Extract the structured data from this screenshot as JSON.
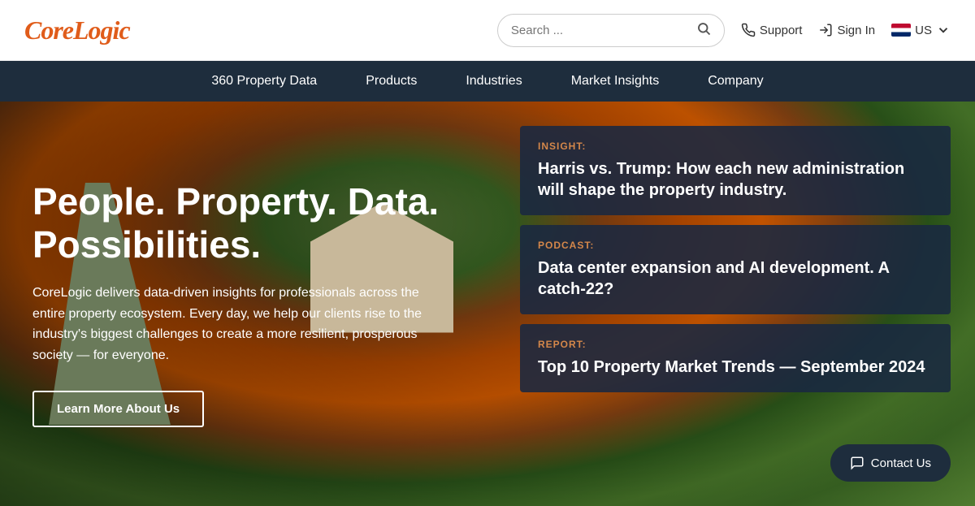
{
  "header": {
    "logo": "CoreLogic",
    "search_placeholder": "Search ...",
    "support_label": "Support",
    "signin_label": "Sign In",
    "region_label": "US"
  },
  "nav": {
    "items": [
      {
        "label": "360 Property Data"
      },
      {
        "label": "Products"
      },
      {
        "label": "Industries"
      },
      {
        "label": "Market Insights"
      },
      {
        "label": "Company"
      }
    ]
  },
  "hero": {
    "heading": "People. Property. Data. Possibilities.",
    "description": "CoreLogic delivers data-driven insights for professionals across the entire property ecosystem. Every day, we help our clients rise to the industry's biggest challenges to create a more resilient, prosperous society — for everyone.",
    "cta_label": "Learn More About Us"
  },
  "cards": [
    {
      "type": "INSIGHT:",
      "title": "Harris vs. Trump: How each new administration will shape the property industry."
    },
    {
      "type": "PODCAST:",
      "title": "Data center expansion and AI development. A catch-22?"
    },
    {
      "type": "REPORT:",
      "title": "Top 10 Property Market Trends — September 2024"
    }
  ],
  "contact": {
    "label": "Contact Us"
  }
}
